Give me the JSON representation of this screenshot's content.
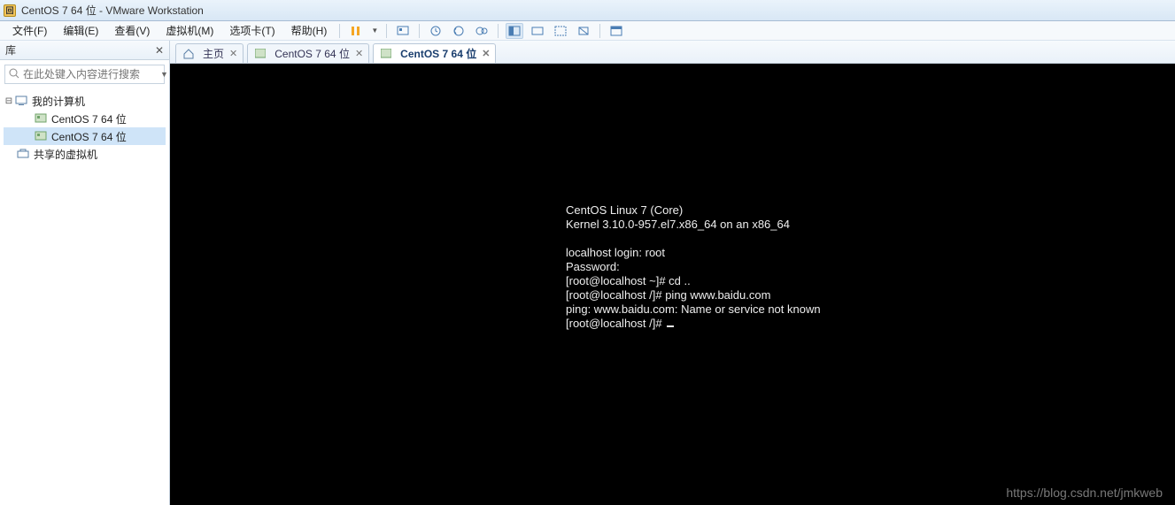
{
  "title": "CentOS 7 64 位 - VMware Workstation",
  "menu": {
    "file": "文件(F)",
    "edit": "编辑(E)",
    "view": "查看(V)",
    "vm": "虚拟机(M)",
    "tabs": "选项卡(T)",
    "help": "帮助(H)"
  },
  "sidebar": {
    "header": "库",
    "search_placeholder": "在此处键入内容进行搜索",
    "tree": {
      "root": "我的计算机",
      "items": [
        "CentOS 7 64 位",
        "CentOS 7 64 位"
      ],
      "shared": "共享的虚拟机"
    }
  },
  "tabs": [
    {
      "label": "主页",
      "icon": "home",
      "active": false
    },
    {
      "label": "CentOS 7 64 位",
      "icon": "vm",
      "active": false
    },
    {
      "label": "CentOS 7 64 位",
      "icon": "vm",
      "active": true
    }
  ],
  "console_lines": [
    "CentOS Linux 7 (Core)",
    "Kernel 3.10.0-957.el7.x86_64 on an x86_64",
    "",
    "localhost login: root",
    "Password:",
    "[root@localhost ~]# cd ..",
    "[root@localhost /]# ping www.baidu.com",
    "ping: www.baidu.com: Name or service not known",
    "[root@localhost /]# "
  ],
  "watermark": "https://blog.csdn.net/jmkweb"
}
